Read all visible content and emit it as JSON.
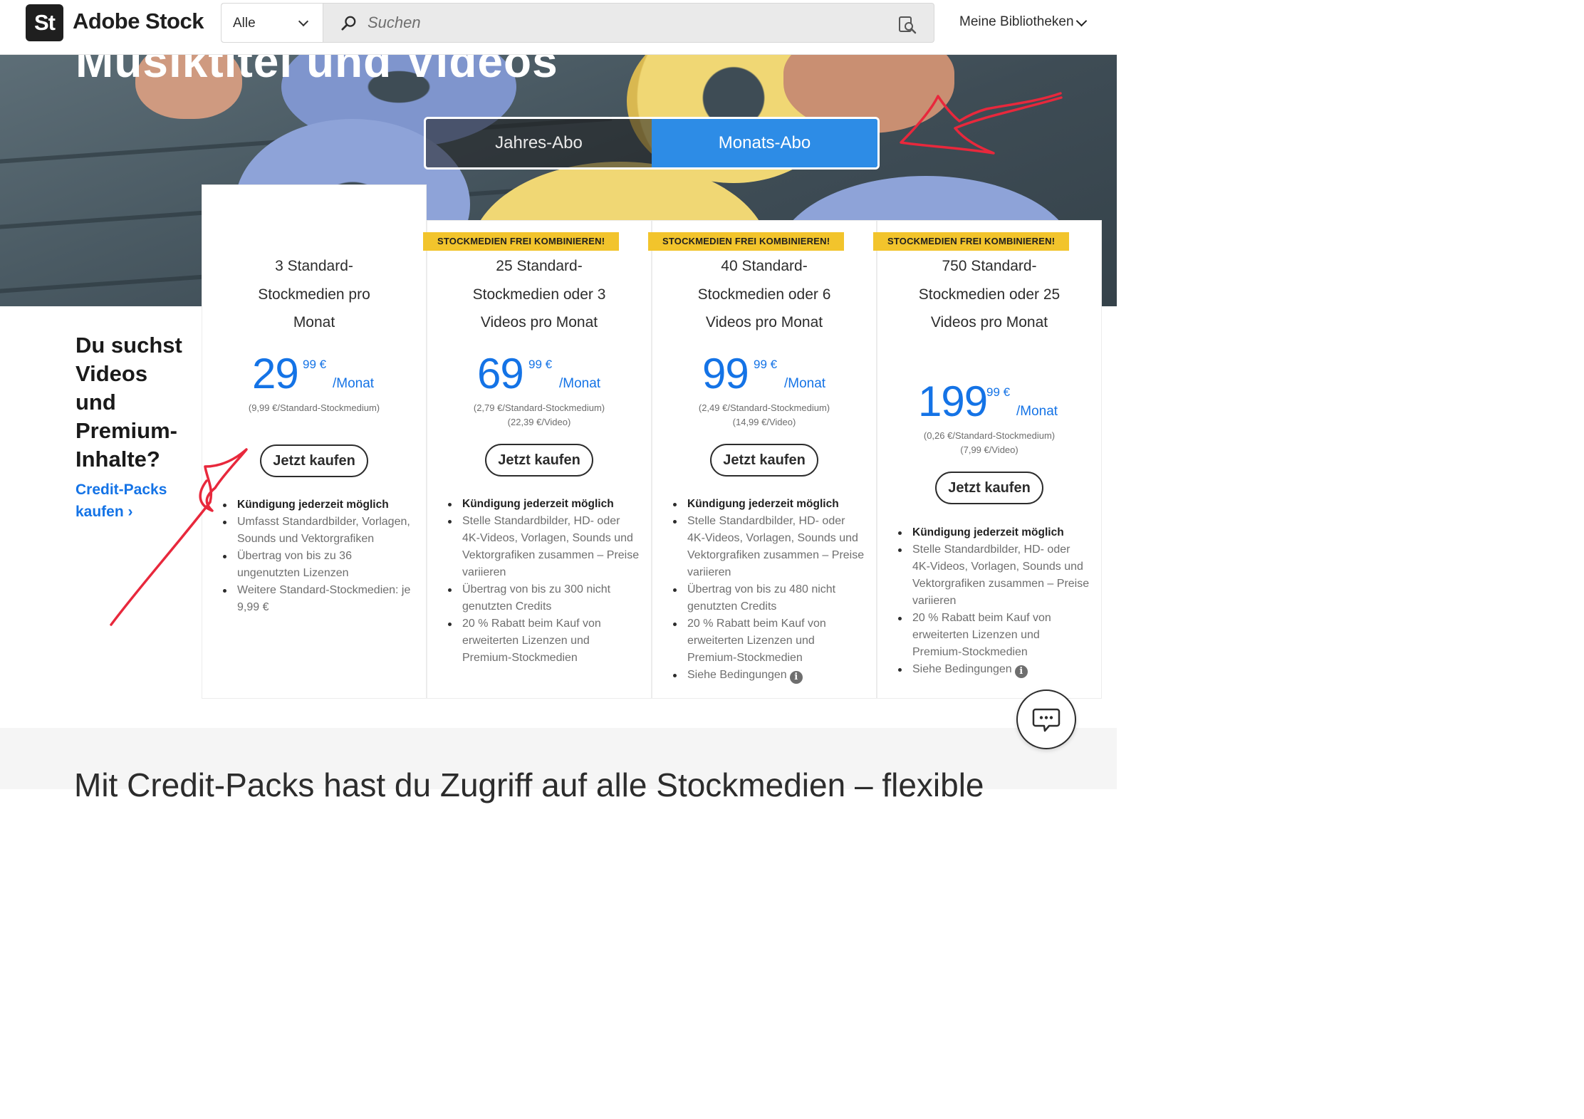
{
  "header": {
    "logo_mark": "St",
    "brand": "Adobe Stock",
    "search_scope": "Alle",
    "search_placeholder": "Suchen",
    "libraries_label": "Meine Bibliotheken"
  },
  "hero": {
    "title": "Musiktitel und Videos",
    "toggle": {
      "yearly": "Jahres-Abo",
      "monthly": "Monats-Abo",
      "selected": "monthly"
    }
  },
  "aside": {
    "title": "Du suchst Videos und Premium-Inhalte?",
    "link": "Credit-Packs kaufen"
  },
  "plans": [
    {
      "badge": "",
      "title": "3 Standard-Stockmedien pro Monat",
      "price_main": "29",
      "price_cents": "99 €",
      "price_per": "/Monat",
      "unit_note_1": "(9,99 €/Standard-Stockmedium)",
      "unit_note_2": "",
      "buy": "Jetzt kaufen",
      "features": [
        "Kündigung jederzeit möglich",
        "Umfasst Standardbilder, Vorlagen, Sounds und Vektorgrafiken",
        "Übertrag von bis zu 36 ungenutzten Lizenzen",
        "Weitere Standard-Stockmedien: je 9,99 €"
      ]
    },
    {
      "badge": "STOCKMEDIEN FREI KOMBINIEREN!",
      "title": "25 Standard-Stockmedien oder 3 Videos pro Monat",
      "price_main": "69",
      "price_cents": "99 €",
      "price_per": "/Monat",
      "unit_note_1": "(2,79 €/Standard-Stockmedium)",
      "unit_note_2": "(22,39 €/Video)",
      "buy": "Jetzt kaufen",
      "features": [
        "Kündigung jederzeit möglich",
        "Stelle Standardbilder, HD- oder 4K-Videos, Vorlagen, Sounds und Vektorgrafiken zusammen – Preise variieren",
        "Übertrag von bis zu 300 nicht genutzten Credits",
        "20 % Rabatt beim Kauf von erweiterten Lizenzen und Premium-Stockmedien"
      ]
    },
    {
      "badge": "STOCKMEDIEN FREI KOMBINIEREN!",
      "title": "40 Standard-Stockmedien oder 6 Videos pro Monat",
      "price_main": "99",
      "price_cents": "99 €",
      "price_per": "/Monat",
      "unit_note_1": "(2,49 €/Standard-Stockmedium)",
      "unit_note_2": "(14,99 €/Video)",
      "buy": "Jetzt kaufen",
      "features": [
        "Kündigung jederzeit möglich",
        "Stelle Standardbilder, HD- oder 4K-Videos, Vorlagen, Sounds und Vektorgrafiken zusammen – Preise variieren",
        "Übertrag von bis zu 480 nicht genutzten Credits",
        "20 % Rabatt beim Kauf von erweiterten Lizenzen und Premium-Stockmedien",
        "Siehe Bedingungen"
      ]
    },
    {
      "badge": "STOCKMEDIEN FREI KOMBINIEREN!",
      "title": "750 Standard-Stockmedien oder 25 Videos pro Monat",
      "price_main": "199",
      "price_cents": "99 €",
      "price_per": "/Monat",
      "unit_note_1": "(0,26 €/Standard-Stockmedium)",
      "unit_note_2": "(7,99 €/Video)",
      "buy": "Jetzt kaufen",
      "features": [
        "Kündigung jederzeit möglich",
        "Stelle Standardbilder, HD- oder 4K-Videos, Vorlagen, Sounds und Vektorgrafiken zusammen – Preise variieren",
        "20 % Rabatt beim Kauf von erweiterten Lizenzen und Premium-Stockmedien",
        "Siehe Bedingungen"
      ]
    }
  ],
  "bottom": {
    "headline": "Mit Credit-Packs hast du Zugriff auf alle Stockmedien – flexible"
  },
  "colors": {
    "accent": "#1473e6",
    "toggle_selected": "#2d8ce6",
    "badge": "#f2c42c",
    "annotation": "#e8283c"
  },
  "icons": {
    "search": "search-icon",
    "visual_search": "visual-search-icon",
    "chat": "chat-icon",
    "info": "info-icon"
  }
}
